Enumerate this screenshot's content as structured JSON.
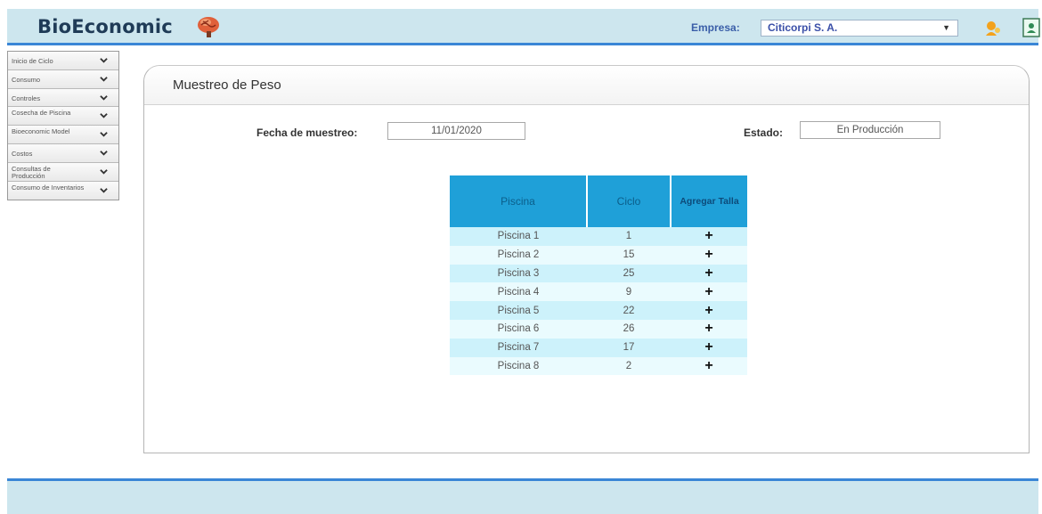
{
  "header": {
    "app_name": "BioEconomic",
    "company_label": "Empresa:",
    "company_value": "Citicorpi S. A."
  },
  "sidebar": {
    "items": [
      {
        "label": "Inicio de Ciclo"
      },
      {
        "label": "Consumo"
      },
      {
        "label": "Controles"
      },
      {
        "label": "Cosecha de Piscina"
      },
      {
        "label": "Bioeconomic Model"
      },
      {
        "label": "Costos"
      },
      {
        "label": "Consultas de Producción"
      },
      {
        "label": "Consumo de Inventarios"
      }
    ]
  },
  "main": {
    "title": "Muestreo de Peso",
    "fecha_label": "Fecha de muestreo:",
    "fecha_value": "11/01/2020",
    "estado_label": "Estado:",
    "estado_value": "En Producción"
  },
  "table": {
    "headers": [
      "Piscina",
      "Ciclo",
      "Agregar Talla"
    ],
    "rows": [
      {
        "piscina": "Piscina 1",
        "ciclo": "1"
      },
      {
        "piscina": "Piscina 2",
        "ciclo": "15"
      },
      {
        "piscina": "Piscina 3",
        "ciclo": "25"
      },
      {
        "piscina": "Piscina 4",
        "ciclo": "9"
      },
      {
        "piscina": "Piscina 5",
        "ciclo": "22"
      },
      {
        "piscina": "Piscina 6",
        "ciclo": "26"
      },
      {
        "piscina": "Piscina 7",
        "ciclo": "17"
      },
      {
        "piscina": "Piscina 8",
        "ciclo": "2"
      }
    ],
    "add_symbol": "+"
  },
  "colors": {
    "header_bg": "#cde6ee",
    "accent_blue": "#3a86d6",
    "table_header": "#1fa0d8",
    "row_odd": "#cdf2fb",
    "row_even": "#eafbfe"
  },
  "icons": {
    "logo": "brain-logo-icon",
    "notifications": "bell-icon",
    "user": "user-icon",
    "sidebar_chevron": "chevron-down-icon",
    "add": "plus-icon"
  }
}
